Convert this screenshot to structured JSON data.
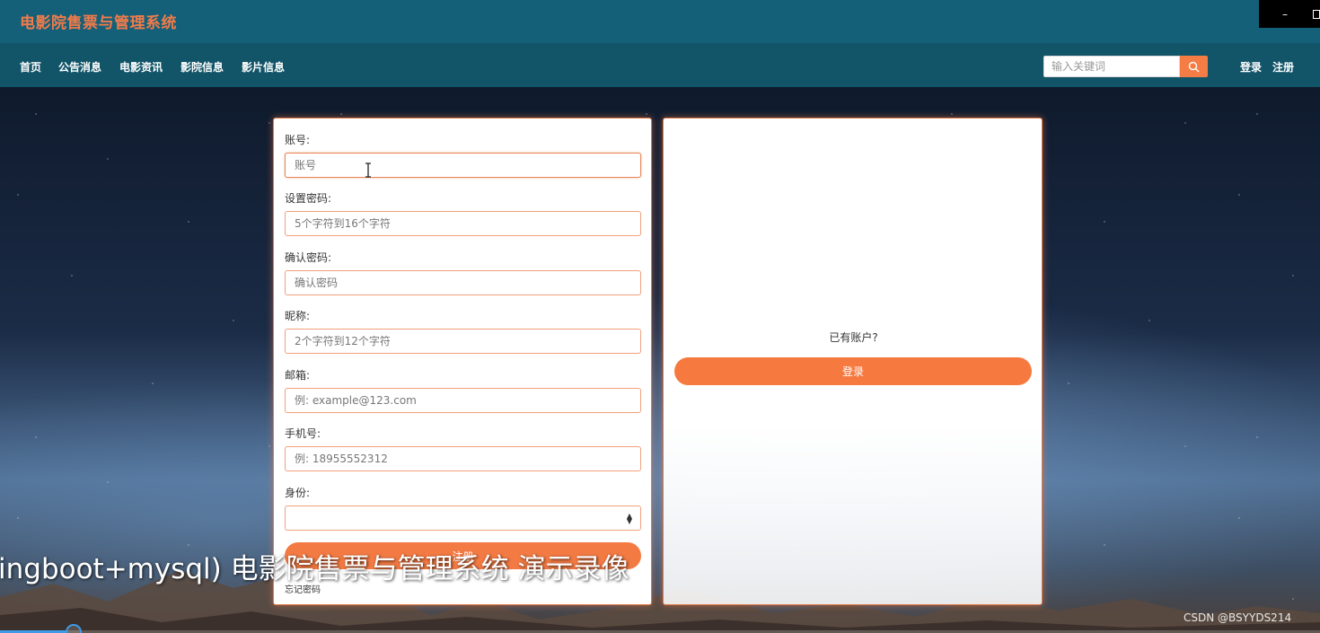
{
  "header": {
    "site_title": "电影院售票与管理系统"
  },
  "window_controls": {
    "minimize_label": "–"
  },
  "nav": {
    "items": [
      {
        "label": "首页"
      },
      {
        "label": "公告消息"
      },
      {
        "label": "电影资讯"
      },
      {
        "label": "影院信息"
      },
      {
        "label": "影片信息"
      }
    ],
    "search": {
      "placeholder": "输入关键词",
      "icon": "search-icon"
    },
    "login_label": "登录",
    "register_label": "注册"
  },
  "register_form": {
    "fields": [
      {
        "label": "账号:",
        "placeholder": "账号"
      },
      {
        "label": "设置密码:",
        "placeholder": "5个字符到16个字符"
      },
      {
        "label": "确认密码:",
        "placeholder": "确认密码"
      },
      {
        "label": "昵称:",
        "placeholder": "2个字符到12个字符"
      },
      {
        "label": "邮箱:",
        "placeholder": "例: example@123.com"
      },
      {
        "label": "手机号:",
        "placeholder": "例: 18955552312"
      }
    ],
    "identity": {
      "label": "身份:",
      "selected": ""
    },
    "submit_label": "注册",
    "forgot_label": "忘记密码"
  },
  "login_panel": {
    "prompt": "已有账户?",
    "login_button_label": "登录"
  },
  "video_overlay": {
    "caption": "ingboot+mysql) 电影院售票与管理系统 演示录像",
    "progress": 0.05
  },
  "watermark": "CSDN @BSYYDS214",
  "colors": {
    "title_bar": "#146079",
    "nav_bar": "#125569",
    "accent": "#f37a43",
    "site_title": "#f17b4a"
  }
}
